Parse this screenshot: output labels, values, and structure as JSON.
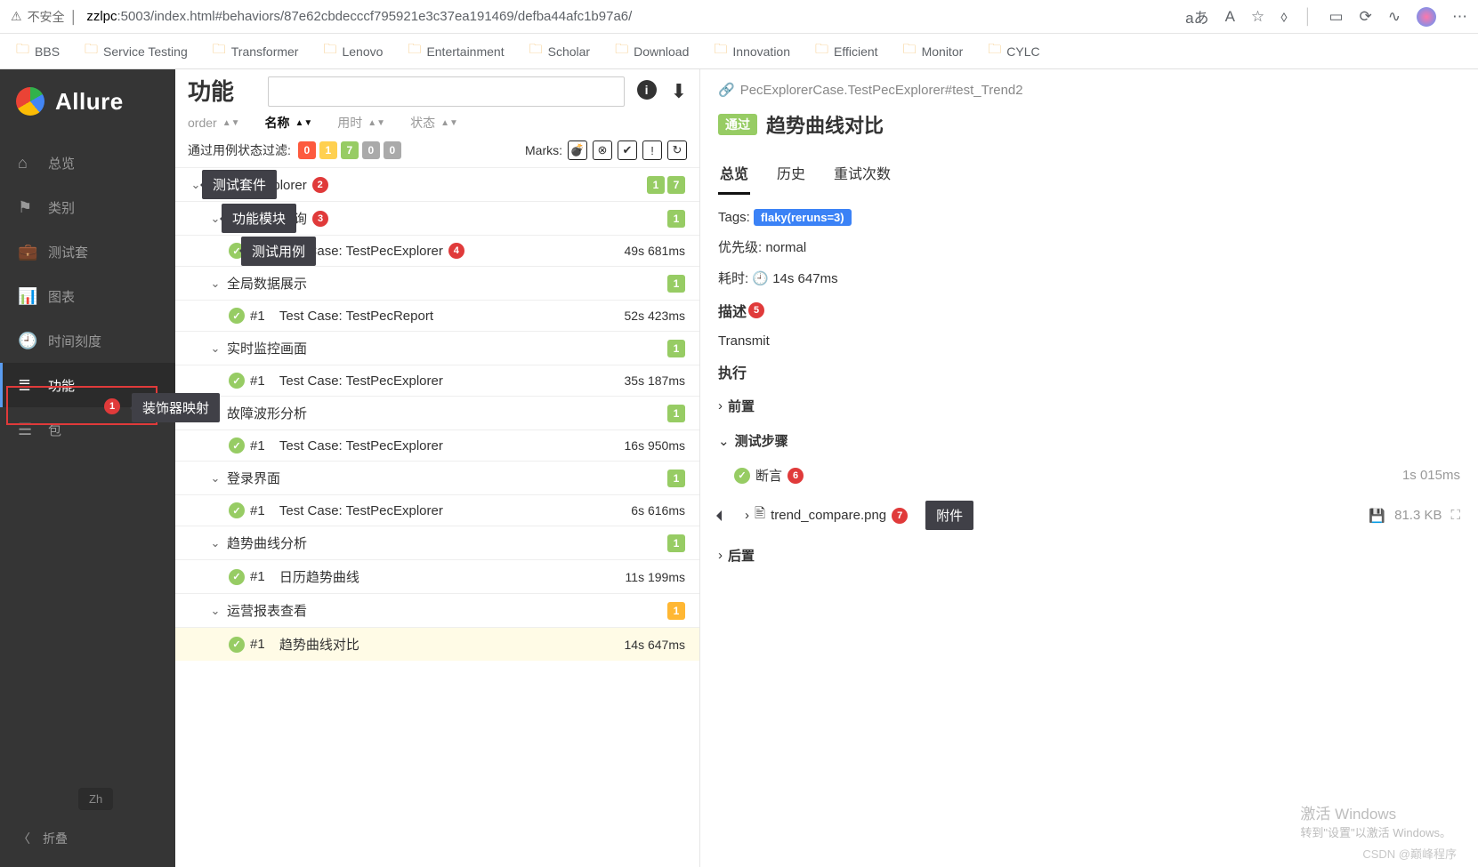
{
  "browser": {
    "security": "不安全",
    "host": "zzlpc",
    "port_path": ":5003/index.html#behaviors/87e62cbdecccf795921e3c37ea191469/defba44afc1b97a6/",
    "actions": [
      "aあ",
      "A",
      "☆",
      "⬨",
      "▭",
      "⟳",
      "∿",
      "⊕",
      "⋯"
    ]
  },
  "bookmarks": [
    "BBS",
    "Service Testing",
    "Transformer",
    "Lenovo",
    "Entertainment",
    "Scholar",
    "Download",
    "Innovation",
    "Efficient",
    "Monitor",
    "CYLC"
  ],
  "logo": "Allure",
  "nav": [
    {
      "icon": "home",
      "label": "总览"
    },
    {
      "icon": "flag",
      "label": "类别"
    },
    {
      "icon": "briefcase",
      "label": "测试套"
    },
    {
      "icon": "chart",
      "label": "图表"
    },
    {
      "icon": "clock",
      "label": "时间刻度"
    },
    {
      "icon": "list",
      "label": "功能",
      "active": true
    },
    {
      "icon": "pkg",
      "label": "包"
    }
  ],
  "lang": "Zh",
  "collapse": "折叠",
  "center": {
    "title": "功能",
    "sort_cols": [
      {
        "label": "order",
        "active": false
      },
      {
        "label": "名称",
        "active": true
      },
      {
        "label": "用时",
        "active": false
      },
      {
        "label": "状态",
        "active": false
      }
    ],
    "filter_label": "通过用例状态过滤:",
    "filter_counts": [
      "0",
      "1",
      "7",
      "0",
      "0"
    ],
    "marks_label": "Marks:"
  },
  "tree": [
    {
      "type": "group",
      "indent": 0,
      "label": "测试PecExplorer",
      "badges": [
        "1",
        "7"
      ],
      "ann": 2
    },
    {
      "type": "group",
      "indent": 1,
      "label": "事件记录查询",
      "badges": [
        "1"
      ],
      "ann": 3
    },
    {
      "type": "case",
      "indent": 2,
      "num": "#1",
      "label": "Test Case: TestPecExplorer",
      "time": "49s 681ms",
      "ann": 4
    },
    {
      "type": "group",
      "indent": 1,
      "label": "全局数据展示",
      "badges": [
        "1"
      ]
    },
    {
      "type": "case",
      "indent": 2,
      "num": "#1",
      "label": "Test Case: TestPecReport",
      "time": "52s 423ms"
    },
    {
      "type": "group",
      "indent": 1,
      "label": "实时监控画面",
      "badges": [
        "1"
      ]
    },
    {
      "type": "case",
      "indent": 2,
      "num": "#1",
      "label": "Test Case: TestPecExplorer",
      "time": "35s 187ms"
    },
    {
      "type": "group",
      "indent": 1,
      "label": "故障波形分析",
      "badges": [
        "1"
      ]
    },
    {
      "type": "case",
      "indent": 2,
      "num": "#1",
      "label": "Test Case: TestPecExplorer",
      "time": "16s 950ms"
    },
    {
      "type": "group",
      "indent": 1,
      "label": "登录界面",
      "badges": [
        "1"
      ]
    },
    {
      "type": "case",
      "indent": 2,
      "num": "#1",
      "label": "Test Case: TestPecExplorer",
      "time": "6s 616ms"
    },
    {
      "type": "group",
      "indent": 1,
      "label": "趋势曲线分析",
      "badges": [
        "1"
      ]
    },
    {
      "type": "case",
      "indent": 2,
      "num": "#1",
      "label": "日历趋势曲线",
      "time": "11s 199ms"
    },
    {
      "type": "group",
      "indent": 1,
      "label": "运营报表查看",
      "badges": [
        "1"
      ],
      "badge_color": "orange"
    },
    {
      "type": "case",
      "indent": 2,
      "num": "#1",
      "label": "趋势曲线对比",
      "time": "14s 647ms",
      "selected": true
    }
  ],
  "tooltips": {
    "1": "装饰器映射",
    "2": "测试套件",
    "3": "功能模块",
    "4": "测试用例",
    "7": "附件"
  },
  "detail": {
    "path": "PecExplorerCase.TestPecExplorer#test_Trend2",
    "status": "通过",
    "title": "趋势曲线对比",
    "tabs": [
      "总览",
      "历史",
      "重试次数"
    ],
    "tags_label": "Tags:",
    "tag": "flaky(reruns=3)",
    "priority_label": "优先级:",
    "priority": "normal",
    "duration_label": "耗时:",
    "duration": "14s 647ms",
    "desc_label": "描述",
    "desc": "Transmit",
    "exec_label": "执行",
    "precond": "前置",
    "steps_label": "测试步骤",
    "assert_label": "断言",
    "assert_time": "1s 015ms",
    "attach_name": "trend_compare.png",
    "attach_size": "81.3 KB",
    "postcond": "后置"
  },
  "watermark": {
    "l1": "激活 Windows",
    "l2": "转到\"设置\"以激活 Windows。"
  },
  "csdn": "CSDN @巅峰程序"
}
